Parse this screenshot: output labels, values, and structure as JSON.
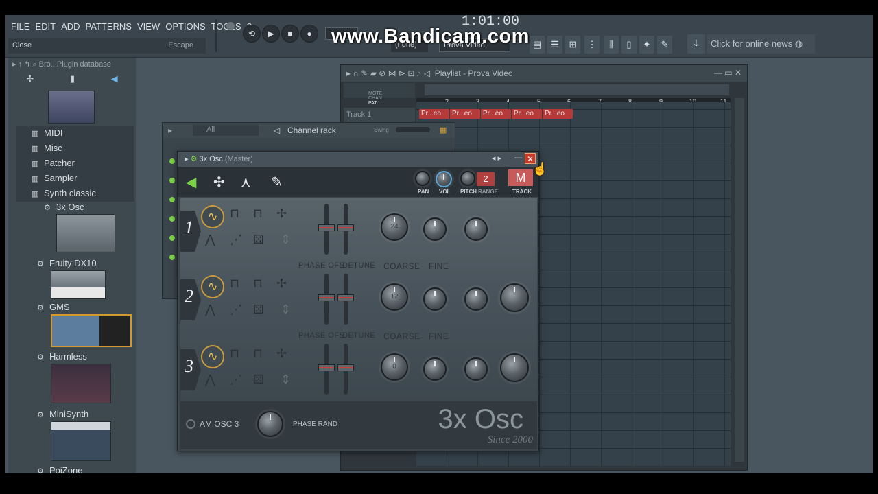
{
  "menu": [
    "FILE",
    "EDIT",
    "ADD",
    "PATTERNS",
    "VIEW",
    "OPTIONS",
    "TOOLS",
    "?"
  ],
  "hint": {
    "text": "Close",
    "key": "Escape"
  },
  "transport": {
    "time": "1:01:00",
    "pattern_selector": "(none)",
    "song_name": "Prova Video"
  },
  "watermark": "www.Bandicam.com",
  "news": "Click for online news",
  "browser": {
    "path": "Bro.. Plugin database",
    "items": [
      {
        "label": "MIDI"
      },
      {
        "label": "Misc"
      },
      {
        "label": "Patcher"
      },
      {
        "label": "Sampler"
      },
      {
        "label": "Synth classic"
      },
      {
        "label": "3x Osc"
      },
      {
        "label": "Fruity DX10"
      },
      {
        "label": "GMS"
      },
      {
        "label": "Harmless"
      },
      {
        "label": "MiniSynth"
      },
      {
        "label": "PoiZone"
      }
    ]
  },
  "playlist": {
    "title": "Playlist - Prova Video",
    "track": "Track 1",
    "ruler": [
      "2",
      "3",
      "4",
      "5",
      "6",
      "7",
      "8",
      "9",
      "10",
      "11"
    ],
    "clip_label": "Pr...eo",
    "ruler_labels": [
      "MOTE",
      "CHAN",
      "PAT"
    ]
  },
  "channel_rack": {
    "title": "Channel rack",
    "filter": "All",
    "swing_label": "Swing"
  },
  "plugin": {
    "title": "3x Osc",
    "subtitle": "(Master)",
    "controls": {
      "pan": "PAN",
      "vol": "VOL",
      "pitch": "PITCH",
      "range": "RANGE",
      "track": "TRACK",
      "range_value": "2",
      "track_btn": "M"
    },
    "osc": [
      {
        "num": "1",
        "coarse": "24"
      },
      {
        "num": "2",
        "coarse": "12"
      },
      {
        "num": "3",
        "coarse": "0"
      }
    ],
    "labels": {
      "phase_ofs": "PHASE OFS",
      "detune": "DETUNE",
      "coarse": "COARSE",
      "fine": "FINE"
    },
    "footer": {
      "am": "AM OSC 3",
      "phase_rand": "PHASE RAND",
      "logo": "3x Osc",
      "since": "Since 2000"
    }
  }
}
